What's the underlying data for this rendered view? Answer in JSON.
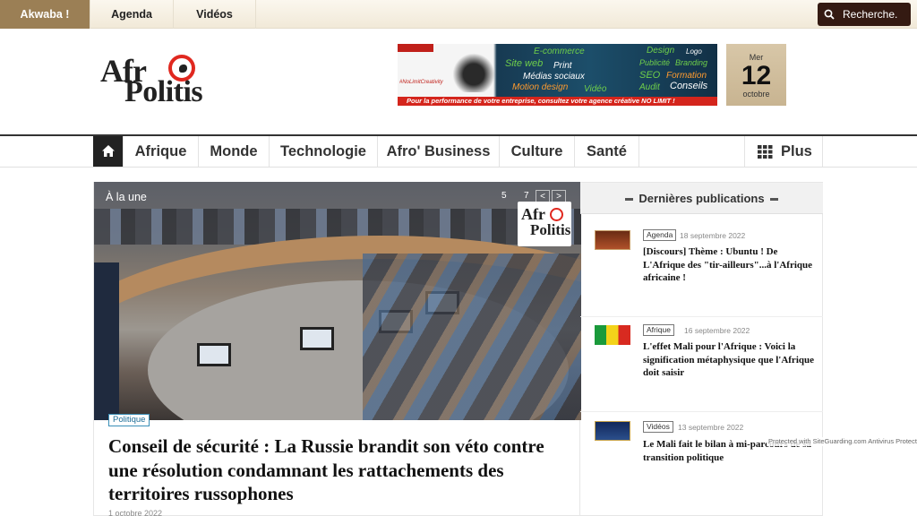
{
  "topbar": {
    "links": [
      "Akwaba !",
      "Agenda",
      "Vidéos"
    ],
    "search_placeholder": "Recherche."
  },
  "logo": {
    "line1": "Afr",
    "line2": "Politis"
  },
  "banner": {
    "words": [
      "E-commerce",
      "Site web",
      "Print",
      "Médias sociaux",
      "Motion design",
      "Design",
      "Logo",
      "Publicité",
      "Branding",
      "Formation",
      "SEO",
      "Audit",
      "Conseils",
      "Vidéo",
      "#NoLimitCreativity"
    ],
    "strip": "Pour la performance de votre entreprise, consultez votre agence créative NO LIMIT !"
  },
  "date": {
    "day": "Mer",
    "number": "12",
    "month": "octobre"
  },
  "nav": {
    "items": [
      "Afrique",
      "Monde",
      "Technologie",
      "Afro' Business",
      "Culture",
      "Santé"
    ],
    "more": "Plus"
  },
  "hero": {
    "label": "À la une",
    "page_current": "5",
    "page_total": "7",
    "prev": "<",
    "next": ">",
    "logo_top": "Afr",
    "logo_bottom": "Politis",
    "category": "Politique",
    "title": "Conseil de sécurité : La Russie brandit son véto contre une résolution condamnant les rattachements des territoires russophones",
    "date": "1 octobre 2022"
  },
  "sidebar": {
    "heading": "Dernières publications",
    "items": [
      {
        "tag": "Agenda",
        "date": "18 septembre 2022",
        "title": "[Discours] Thème : Ubuntu ! De L'Afrique des \"tir-ailleurs\"...à l'Afrique africaine !"
      },
      {
        "tag": "Afrique",
        "date": "16 septembre 2022",
        "title": "L'effet Mali pour l'Afrique : Voici la signification métaphysique que l'Afrique doit saisir"
      },
      {
        "tag": "Vidéos",
        "date": "13 septembre 2022",
        "title": "Le Mali fait le bilan à mi-parcours de sa transition politique"
      }
    ]
  },
  "protection": "Protected with SiteGuarding.com Antivirus Protection"
}
